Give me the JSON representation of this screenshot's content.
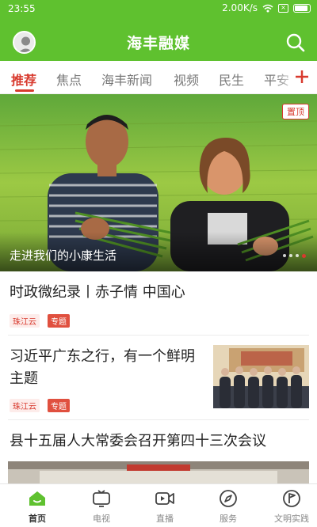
{
  "status_bar": {
    "time": "23:55",
    "network_speed": "2.00K/s"
  },
  "header": {
    "title": "海丰融媒",
    "icons": [
      "avatar",
      "search-icon"
    ]
  },
  "tabs": {
    "items": [
      {
        "label": "推荐",
        "active": true
      },
      {
        "label": "焦点",
        "active": false
      },
      {
        "label": "海丰新闻",
        "active": false
      },
      {
        "label": "视频",
        "active": false
      },
      {
        "label": "民生",
        "active": false
      },
      {
        "label": "平安",
        "active": false
      }
    ],
    "more_icon": "plus-icon"
  },
  "banner": {
    "badge": "置顶",
    "caption": "走进我们的小康生活",
    "slide_count": 4,
    "active_slide": 4
  },
  "news": [
    {
      "title": "时政微纪录丨赤子情 中国心",
      "source": "珠江云",
      "tag": "专题"
    },
    {
      "title_line1": "习近平广东之行，有一个鲜明",
      "title_line2": "主题",
      "source": "珠江云",
      "tag": "专题"
    },
    {
      "title": "县十五届人大常委会召开第四十三次会议"
    }
  ],
  "bottom_nav": {
    "items": [
      {
        "label": "首页",
        "icon": "home-icon",
        "active": true
      },
      {
        "label": "电视",
        "icon": "tv-icon",
        "active": false
      },
      {
        "label": "直播",
        "icon": "live-icon",
        "active": false
      },
      {
        "label": "服务",
        "icon": "compass-icon",
        "active": false
      },
      {
        "label": "文明实践",
        "icon": "flag-icon",
        "active": false
      }
    ]
  },
  "colors": {
    "brand_green": "#5fc12f",
    "accent_red": "#d83a2e"
  }
}
